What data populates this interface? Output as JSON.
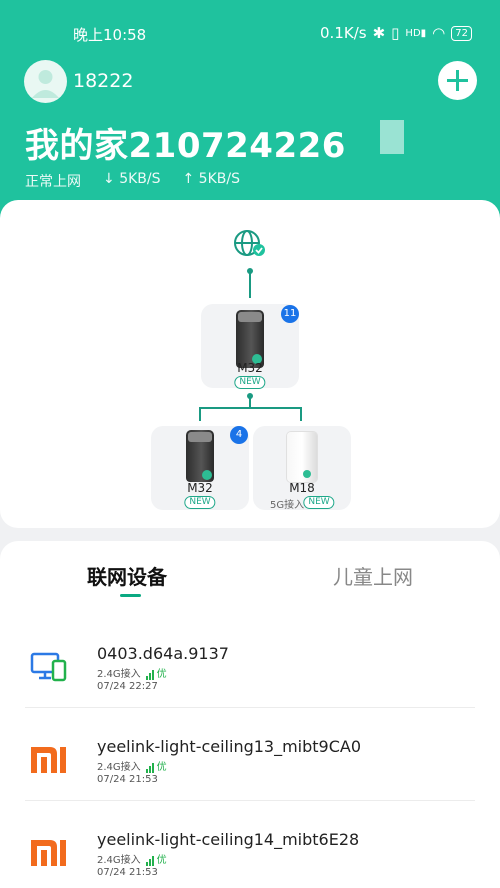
{
  "status_bar": {
    "time": "晚上10:58",
    "speed": "0.1K/s",
    "signal": "HD",
    "battery": "72"
  },
  "header": {
    "phone": "18222",
    "home_title": "我的家210724226",
    "net_status": "正常上网",
    "download": "5KB/S",
    "upload": "5KB/S",
    "bg_color": "#1fc29e"
  },
  "topology": {
    "main_node": {
      "model": "M32",
      "tag": "NEW",
      "count": "11"
    },
    "child_nodes": [
      {
        "model": "M32",
        "tag": "NEW",
        "count": "4",
        "sub": ""
      },
      {
        "model": "M18",
        "tag": "NEW",
        "count": "",
        "sub": "5G接入"
      }
    ]
  },
  "tabs": [
    {
      "label": "联网设备",
      "active": true
    },
    {
      "label": "儿童上网",
      "active": false
    }
  ],
  "devices": [
    {
      "name": "0403.d64a.9137",
      "band": "2.4G接入",
      "quality": "优",
      "time": "07/24 22:27",
      "icon": "computer-phone-icon"
    },
    {
      "name": "yeelink-light-ceiling13_mibt9CA0",
      "band": "2.4G接入",
      "quality": "优",
      "time": "07/24 21:53",
      "icon": "mi-logo-icon"
    },
    {
      "name": "yeelink-light-ceiling14_mibt6E28",
      "band": "2.4G接入",
      "quality": "优",
      "time": "07/24 21:53",
      "icon": "mi-logo-icon"
    }
  ]
}
